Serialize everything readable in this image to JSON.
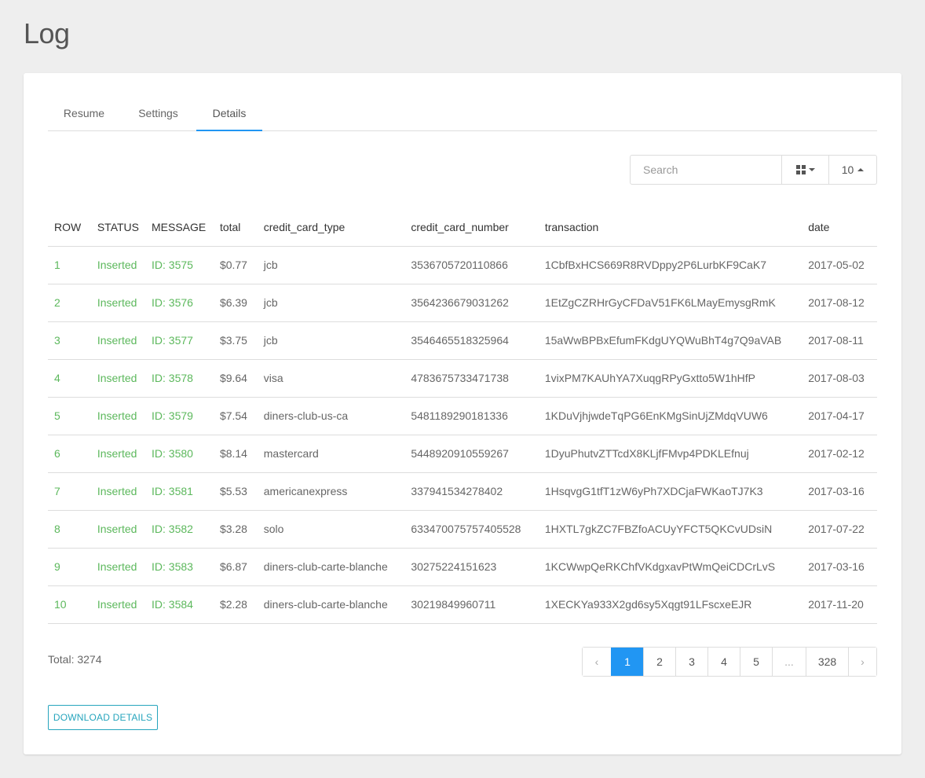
{
  "page": {
    "title": "Log"
  },
  "tabs": [
    {
      "label": "Resume",
      "active": false
    },
    {
      "label": "Settings",
      "active": false
    },
    {
      "label": "Details",
      "active": true
    }
  ],
  "toolbar": {
    "search_placeholder": "Search",
    "columns_icon": "grid-icon",
    "page_size": "10"
  },
  "colors": {
    "accent": "#2196f3",
    "success": "#5cb85c",
    "teal": "#26a5bd"
  },
  "table": {
    "columns": [
      "ROW",
      "STATUS",
      "MESSAGE",
      "total",
      "credit_card_type",
      "credit_card_number",
      "transaction",
      "date"
    ],
    "rows": [
      [
        "1",
        "Inserted",
        "ID: 3575",
        "$0.77",
        "jcb",
        "3536705720110866",
        "1CbfBxHCS669R8RVDppy2P6LurbKF9CaK7",
        "2017-05-02"
      ],
      [
        "2",
        "Inserted",
        "ID: 3576",
        "$6.39",
        "jcb",
        "3564236679031262",
        "1EtZgCZRHrGyCFDaV51FK6LMayEmysgRmK",
        "2017-08-12"
      ],
      [
        "3",
        "Inserted",
        "ID: 3577",
        "$3.75",
        "jcb",
        "3546465518325964",
        "15aWwBPBxEfumFKdgUYQWuBhT4g7Q9aVAB",
        "2017-08-11"
      ],
      [
        "4",
        "Inserted",
        "ID: 3578",
        "$9.64",
        "visa",
        "4783675733471738",
        "1vixPM7KAUhYA7XuqgRPyGxtto5W1hHfP",
        "2017-08-03"
      ],
      [
        "5",
        "Inserted",
        "ID: 3579",
        "$7.54",
        "diners-club-us-ca",
        "5481189290181336",
        "1KDuVjhjwdeTqPG6EnKMgSinUjZMdqVUW6",
        "2017-04-17"
      ],
      [
        "6",
        "Inserted",
        "ID: 3580",
        "$8.14",
        "mastercard",
        "5448920910559267",
        "1DyuPhutvZTTcdX8KLjfFMvp4PDKLEfnuj",
        "2017-02-12"
      ],
      [
        "7",
        "Inserted",
        "ID: 3581",
        "$5.53",
        "americanexpress",
        "337941534278402",
        "1HsqvgG1tfT1zW6yPh7XDCjaFWKaoTJ7K3",
        "2017-03-16"
      ],
      [
        "8",
        "Inserted",
        "ID: 3582",
        "$3.28",
        "solo",
        "633470075757405528",
        "1HXTL7gkZC7FBZfoACUyYFCT5QKCvUDsiN",
        "2017-07-22"
      ],
      [
        "9",
        "Inserted",
        "ID: 3583",
        "$6.87",
        "diners-club-carte-blanche",
        "30275224151623",
        "1KCWwpQeRKChfVKdgxavPtWmQeiCDCrLvS",
        "2017-03-16"
      ],
      [
        "10",
        "Inserted",
        "ID: 3584",
        "$2.28",
        "diners-club-carte-blanche",
        "30219849960711",
        "1XECKYa933X2gd6sy5Xqgt91LFscxeEJR",
        "2017-11-20"
      ]
    ]
  },
  "footer": {
    "total_label": "Total: 3274",
    "pagination": {
      "prev": "‹",
      "pages": [
        "1",
        "2",
        "3",
        "4",
        "5",
        "...",
        "328"
      ],
      "active": "1",
      "next": "›"
    },
    "download_label": "DOWNLOAD DETAILS"
  }
}
